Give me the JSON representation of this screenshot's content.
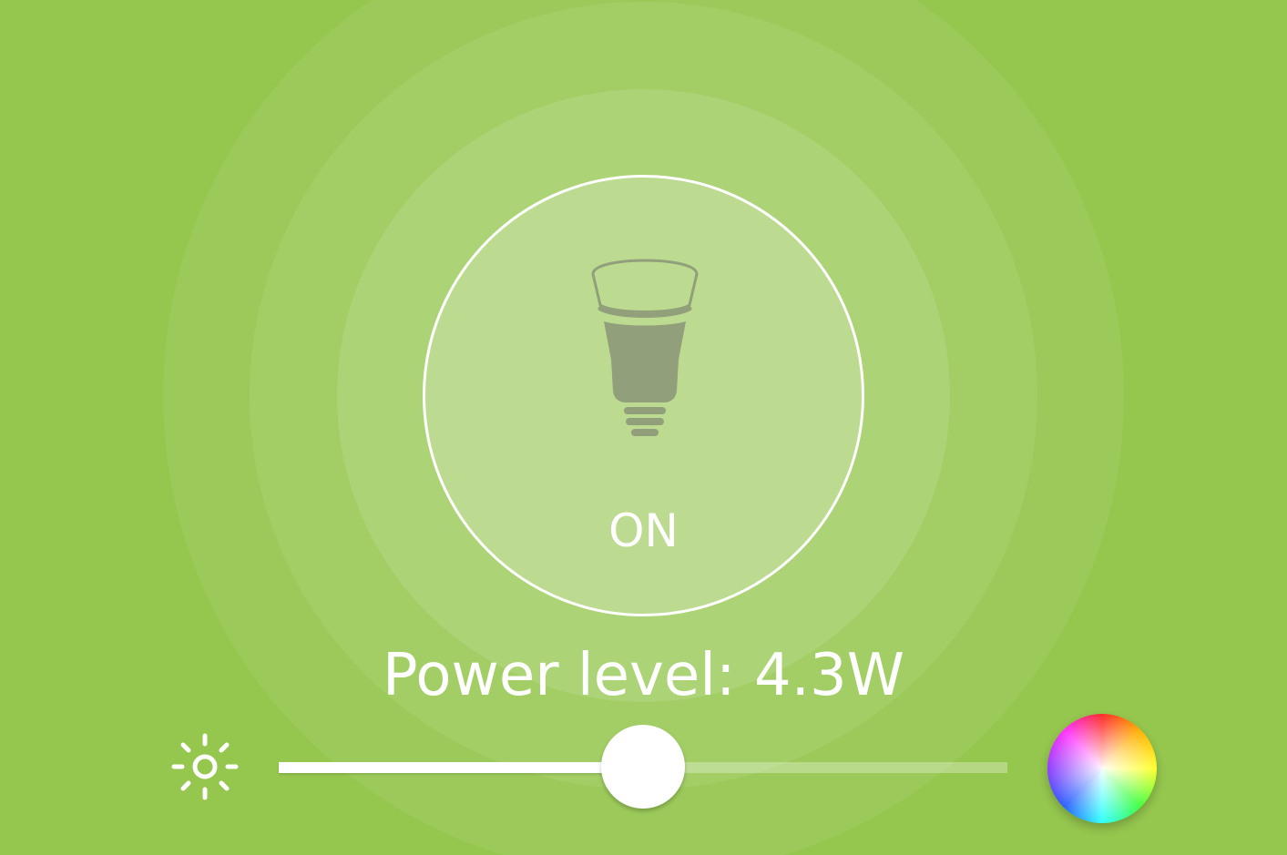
{
  "light": {
    "state_label": "ON",
    "power_label": "Power level: 4.3W"
  },
  "brightness": {
    "level": 0.5
  },
  "colors": {
    "background": "#95c64e",
    "accent": "#ffffff",
    "bulb": "#919f7b"
  },
  "icons": {
    "bulb": "light-bulb-icon",
    "brightness": "sun-icon",
    "color": "color-wheel-icon"
  }
}
